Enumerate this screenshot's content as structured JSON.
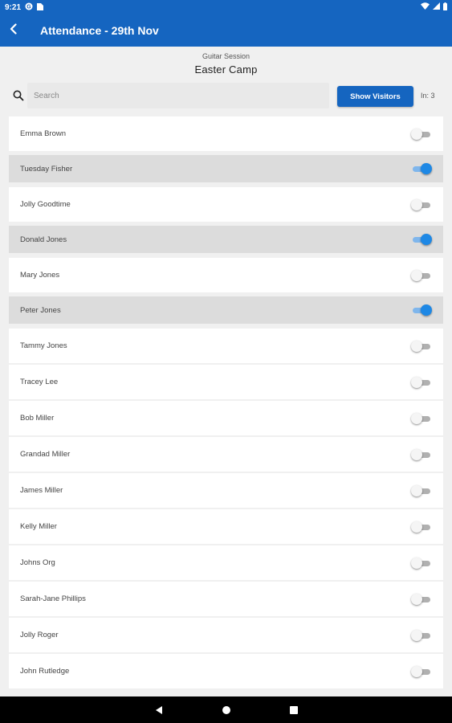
{
  "status_bar": {
    "time": "9:21",
    "icons": [
      "notification-g-icon",
      "sim-card-icon",
      "wifi-icon",
      "signal-icon",
      "battery-icon"
    ]
  },
  "app_bar": {
    "title": "Attendance - 29th Nov",
    "back_icon": "back-arrow-icon",
    "color": "#1565c0"
  },
  "header": {
    "subtitle": "Guitar Session",
    "title": "Easter Camp"
  },
  "toolbar": {
    "search_placeholder": "Search",
    "search_value": "",
    "show_visitors_label": "Show Visitors",
    "in_count": "In: 3"
  },
  "attendees": [
    {
      "name": "Emma Brown",
      "present": false
    },
    {
      "name": "Tuesday Fisher",
      "present": true
    },
    {
      "name": "Jolly Goodtime",
      "present": false
    },
    {
      "name": "Donald Jones",
      "present": true
    },
    {
      "name": "Mary Jones",
      "present": false
    },
    {
      "name": "Peter Jones",
      "present": true
    },
    {
      "name": "Tammy Jones",
      "present": false
    },
    {
      "name": "Tracey Lee",
      "present": false
    },
    {
      "name": "Bob Miller",
      "present": false
    },
    {
      "name": "Grandad Miller",
      "present": false
    },
    {
      "name": "James Miller",
      "present": false
    },
    {
      "name": "Kelly Miller",
      "present": false
    },
    {
      "name": "Johns Org",
      "present": false
    },
    {
      "name": "Sarah-Jane Phillips",
      "present": false
    },
    {
      "name": "Jolly Roger",
      "present": false
    },
    {
      "name": "John Rutledge",
      "present": false
    }
  ],
  "nav_bar": {
    "buttons": [
      "back-triangle-icon",
      "home-circle-icon",
      "recents-square-icon"
    ]
  },
  "colors": {
    "primary": "#1565c0",
    "toggle_on": "#1e88e5",
    "present_row": "#dcdcdc"
  }
}
